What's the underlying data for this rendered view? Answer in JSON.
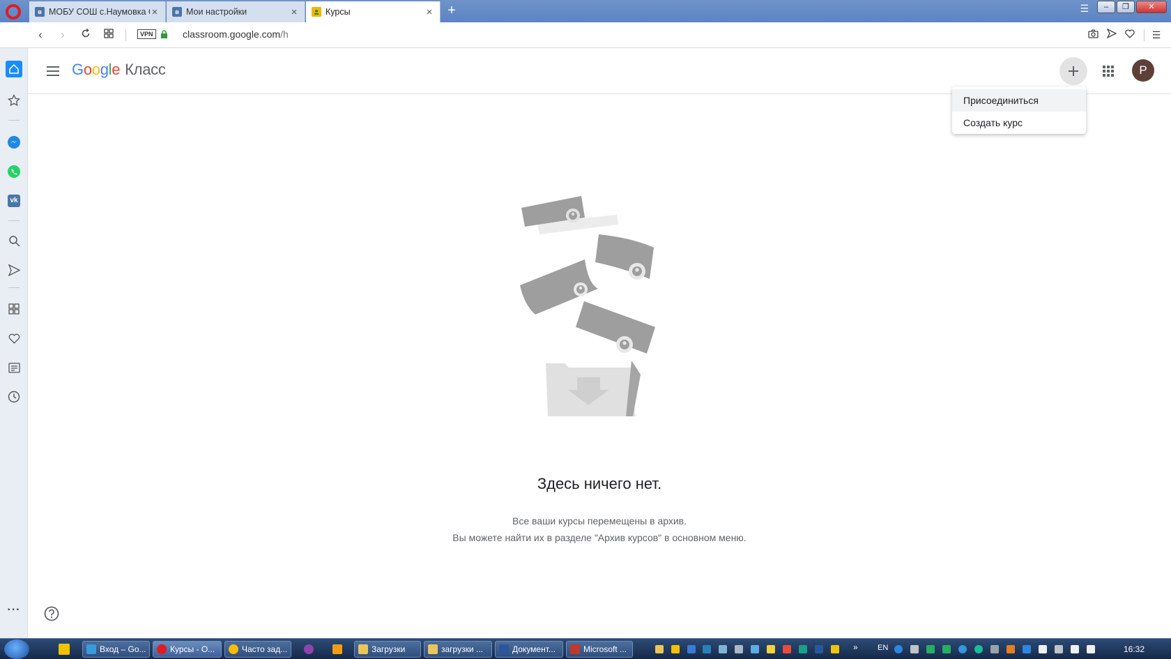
{
  "browser": {
    "tabs": [
      {
        "title": "МОБУ СОШ с.Наумовка С",
        "favicon": "vk-icon",
        "active": false
      },
      {
        "title": "Мои настройки",
        "favicon": "vk-icon",
        "active": false
      },
      {
        "title": "Курсы",
        "favicon": "classroom-icon",
        "active": true
      }
    ],
    "vpn_label": "VPN",
    "url_domain": "classroom.google.com",
    "url_path": "/h"
  },
  "header": {
    "logo_letters": [
      "G",
      "o",
      "o",
      "g",
      "l",
      "e"
    ],
    "product_name": "Класс",
    "avatar_letter": "P"
  },
  "menu": {
    "items": [
      {
        "label": "Присоединиться"
      },
      {
        "label": "Создать курс"
      }
    ]
  },
  "empty_state": {
    "title": "Здесь ничего нет.",
    "line1": "Все ваши курсы перемещены в архив.",
    "line2": "Вы можете найти их в разделе \"Архив курсов\" в основном меню."
  },
  "taskbar": {
    "items": [
      {
        "label": "Вход – Go..."
      },
      {
        "label": "Курсы - О..."
      },
      {
        "label": "Часто зад..."
      },
      {
        "label": "Загрузки"
      },
      {
        "label": "загрузки ..."
      },
      {
        "label": "Документ..."
      },
      {
        "label": "Microsoft ..."
      }
    ],
    "lang": "EN",
    "clock": "16:32"
  },
  "colors": {
    "accent_blue": "#4285f4",
    "avatar_bg": "#5d4037",
    "opera_red": "#e01b24"
  }
}
